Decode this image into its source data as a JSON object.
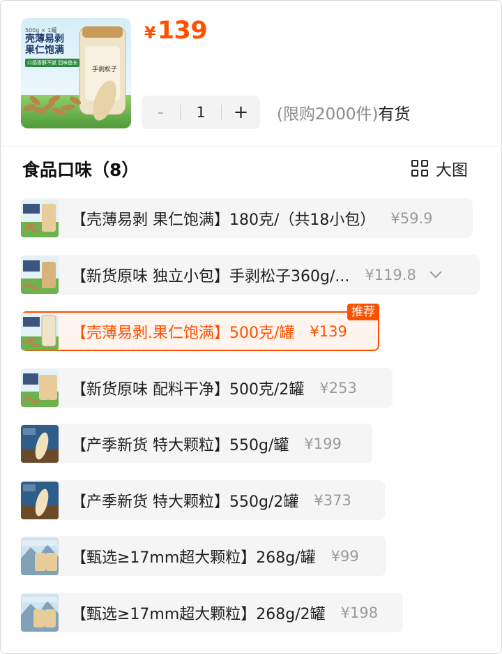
{
  "product": {
    "price_symbol": "¥",
    "price": "139",
    "thumb_label": "壳薄易剥 果仁饱满",
    "thumb_sub": "口感香酥不腻 回味悠长",
    "thumb_spec": "500g × 1罐",
    "thumb_jar": "手剥松子"
  },
  "stepper": {
    "minus": "-",
    "qty": "1",
    "plus": "+"
  },
  "stock": {
    "limit": "(限购2000件)",
    "status": "有货"
  },
  "section": {
    "title": "食品口味（8）",
    "bigview_label": "大图"
  },
  "options": [
    {
      "label": "【壳薄易剥 果仁饱满】180克/（共18小包）",
      "price": "¥59.9",
      "selected": false
    },
    {
      "label": "【新货原味 独立小包】手剥松子360g/...",
      "price": "¥119.8",
      "selected": false,
      "expandable": true
    },
    {
      "label": "【壳薄易剥.果仁饱满】500克/罐",
      "price": "¥139",
      "selected": true,
      "badge": "推荐"
    },
    {
      "label": "【新货原味 配料干净】500克/2罐",
      "price": "¥253",
      "selected": false
    },
    {
      "label": "【产季新货 特大颗粒】550g/罐",
      "price": "¥199",
      "selected": false
    },
    {
      "label": "【产季新货 特大颗粒】550g/2罐",
      "price": "¥373",
      "selected": false
    },
    {
      "label": "【甄选≥17mm超大颗粒】268g/罐",
      "price": "¥99",
      "selected": false
    },
    {
      "label": "【甄选≥17mm超大颗粒】268g/2罐",
      "price": "¥198",
      "selected": false
    }
  ],
  "colors": {
    "accent": "#ff5000",
    "option_bg": "#f5f5f5",
    "muted": "#9a9a9a"
  }
}
